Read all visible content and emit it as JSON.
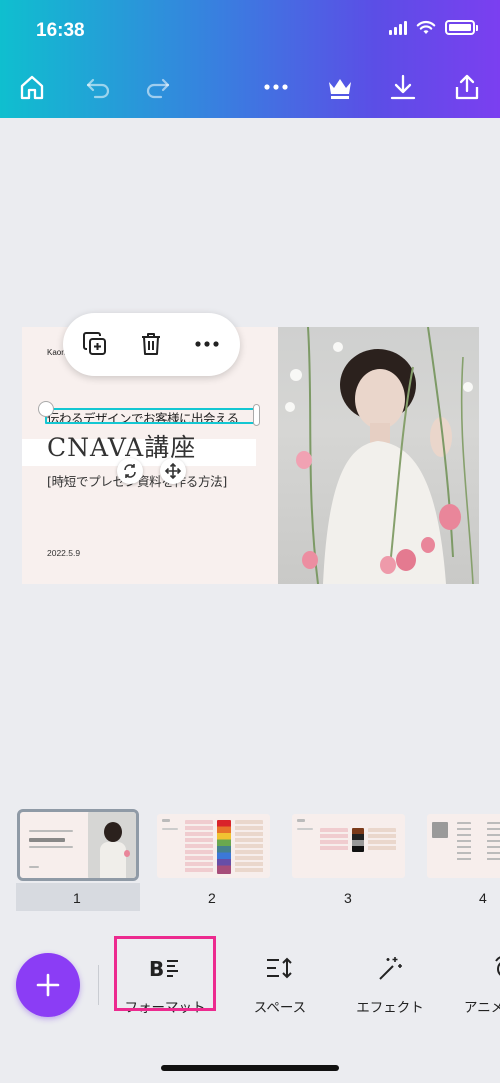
{
  "status": {
    "time": "16:38"
  },
  "toolbar": {
    "home_icon": "home-icon",
    "undo_icon": "undo-icon",
    "redo_icon": "redo-icon",
    "more_icon": "more-icon",
    "premium_icon": "crown-icon",
    "download_icon": "download-icon",
    "share_icon": "share-icon"
  },
  "context_menu": {
    "duplicate_icon": "duplicate-icon",
    "delete_icon": "trash-icon",
    "more_icon": "more-icon"
  },
  "slide": {
    "author": "Kaori",
    "subtitle": "伝わるデザインでお客様に出会える",
    "title": "CNAVA講座",
    "description": "[時短でプレゼン資料を作る方法]",
    "date": "2022.5.9"
  },
  "pages": [
    {
      "number": "1",
      "selected": true
    },
    {
      "number": "2",
      "selected": false
    },
    {
      "number": "3",
      "selected": false
    },
    {
      "number": "4",
      "selected": false
    }
  ],
  "bottom_tools": {
    "add_icon": "plus-icon",
    "format_label": "フォーマット",
    "spacing_label": "スペース",
    "effects_label": "エフェクト",
    "animate_label": "アニメ"
  },
  "colors": {
    "accent": "#8b3df5",
    "selection": "#14c7d2",
    "highlight": "#ec2a8f",
    "header_start": "#0fbfcf",
    "header_end": "#7b3ff0"
  }
}
